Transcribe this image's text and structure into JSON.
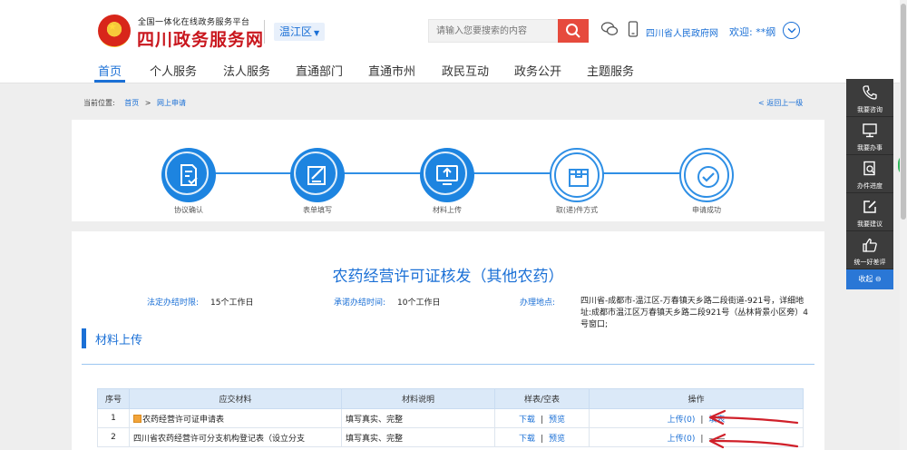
{
  "header": {
    "platform_tagline": "全国一体化在线政务服务平台",
    "site_name": "四川政务服务网",
    "region": "温江区",
    "search_placeholder": "请输入您要搜索的内容",
    "gov_link": "四川省人民政府网",
    "welcome": "欢迎: **纲",
    "icons": [
      "emblem-icon",
      "search-icon",
      "wechat-icon",
      "phone-icon",
      "chevron-down-icon"
    ]
  },
  "nav": {
    "items": [
      "首页",
      "个人服务",
      "法人服务",
      "直通部门",
      "直通市州",
      "政民互动",
      "政务公开",
      "主题服务"
    ],
    "active_index": 0
  },
  "breadcrumb": {
    "prefix": "当前位置:",
    "home": "首页",
    "arrow": ">",
    "current": "网上申请",
    "back": "< 返回上一级"
  },
  "steps": [
    {
      "label": "协议确认",
      "state": "done",
      "icon": "document-check-icon"
    },
    {
      "label": "表单填写",
      "state": "done",
      "icon": "edit-form-icon"
    },
    {
      "label": "材料上传",
      "state": "done",
      "icon": "upload-monitor-icon"
    },
    {
      "label": "取(递)件方式",
      "state": "todo",
      "icon": "package-box-icon"
    },
    {
      "label": "申请成功",
      "state": "todo",
      "icon": "check-circle-icon"
    }
  ],
  "service": {
    "title": "农药经营许可证核发（其他农药）",
    "legal_time_label": "法定办结时限:",
    "legal_time_value": "15个工作日",
    "promise_time_label": "承诺办结时间:",
    "promise_time_value": "10个工作日",
    "location_label": "办理地点:",
    "location_value": "四川省-成都市-温江区-万春镇天乡路二段街道-921号，详细地址:成都市温江区万春镇天乡路二段921号（丛林背景小区旁）4号窗口;"
  },
  "section": {
    "title": "材料上传"
  },
  "table": {
    "headers": [
      "序号",
      "应交材料",
      "材料说明",
      "样表/空表",
      "操作"
    ],
    "rows": [
      {
        "no": "1",
        "material": "农药经营许可证申请表",
        "desc": "填写真实、完整",
        "sample_download": "下载",
        "sample_preview": "预览",
        "upload": "上传(0)",
        "fill": "填表",
        "sep": "|"
      },
      {
        "no": "2",
        "material": "四川省农药经营许可分支机构登记表（设立分支",
        "desc": "填写真实、完整",
        "sample_download": "下载",
        "sample_preview": "预览",
        "upload": "上传(0)",
        "fill": "——",
        "sep": "|"
      }
    ]
  },
  "sidebar": {
    "items": [
      {
        "label": "我要咨询",
        "icon": "phone-icon"
      },
      {
        "label": "我要办事",
        "icon": "monitor-icon"
      },
      {
        "label": "办件进度",
        "icon": "progress-search-icon"
      },
      {
        "label": "我要建议",
        "icon": "edit-icon"
      },
      {
        "label": "统一好差评",
        "icon": "thumbs-up-icon"
      }
    ],
    "collapse": "收起 ⊖"
  },
  "colors": {
    "primary": "#1b70d6",
    "brand_red": "#c9171e",
    "search_red": "#e64a3d",
    "annotation_red": "#d0202a",
    "sidebar_dark": "#3c3c3c"
  }
}
